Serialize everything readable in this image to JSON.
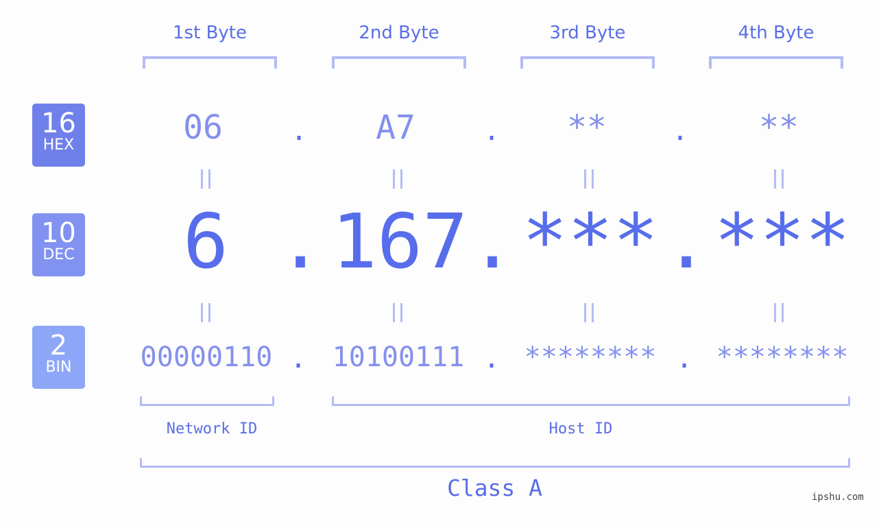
{
  "byte_headers": [
    "1st Byte",
    "2nd Byte",
    "3rd Byte",
    "4th Byte"
  ],
  "badges": [
    {
      "num": "16",
      "label": "HEX",
      "color": "#7080ea"
    },
    {
      "num": "10",
      "label": "DEC",
      "color": "#8192f0"
    },
    {
      "num": "2",
      "label": "BIN",
      "color": "#8ea6f7"
    }
  ],
  "hex": [
    "06",
    "A7",
    "**",
    "**"
  ],
  "dec": [
    "6",
    "167",
    "***",
    "***"
  ],
  "bin": [
    "00000110",
    "10100111",
    "********",
    "********"
  ],
  "separator": ".",
  "network_id_label": "Network ID",
  "host_id_label": "Host ID",
  "class_label": "Class A",
  "watermark": "ipshu.com",
  "colors": {
    "accent": "#576deb",
    "light_value": "#8490ee",
    "bracket": "#b3bcf5",
    "background": "#fcfdfc"
  }
}
